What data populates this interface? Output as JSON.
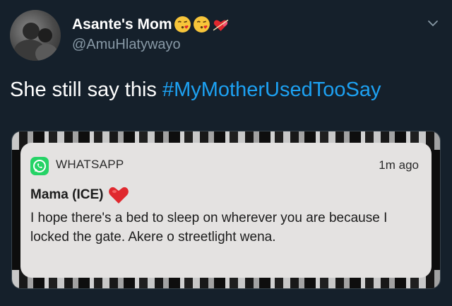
{
  "tweet": {
    "author_name": "Asante's Mom",
    "author_emojis": [
      "face-blowing-kiss-icon",
      "face-blowing-kiss-icon",
      "two-hearts-icon"
    ],
    "handle": "@AmuHlatywayo",
    "text_plain": "She still say this ",
    "hashtag": "#MyMotherUsedTooSay"
  },
  "notification": {
    "app_name": "WHATSAPP",
    "time": "1m ago",
    "sender": "Mama (ICE)",
    "message": "I hope there's a bed to sleep on wherever you are because I locked the gate. Akere o streetlight wena."
  },
  "colors": {
    "background": "#15202b",
    "hashtag": "#1da1f2",
    "secondary_text": "#8899a6",
    "whatsapp_green": "#25d366",
    "heart_red": "#e0282e"
  }
}
